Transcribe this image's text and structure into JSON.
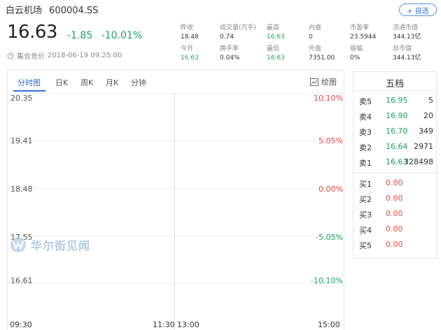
{
  "header": {
    "name": "白云机场",
    "code": "600004.SS",
    "add_button": "+ 自选"
  },
  "quote": {
    "price": "16.63",
    "change": "-1.85",
    "change_pct": "-10.01%",
    "auction_label": "集合竞价",
    "auction_time": "2018-06-19 09:25:00"
  },
  "stats": [
    {
      "label": "昨收",
      "value": "18.48",
      "color": "normal"
    },
    {
      "label": "成交量(万手)",
      "value": "0.74",
      "color": "normal"
    },
    {
      "label": "最高",
      "value": "16.63",
      "color": "green"
    },
    {
      "label": "内盘",
      "value": "0",
      "color": "normal"
    },
    {
      "label": "市盈率",
      "value": "23.5944",
      "color": "normal"
    },
    {
      "label": "流通市值",
      "value": "344.13亿",
      "color": "normal"
    },
    {
      "label": "今开",
      "value": "16.63",
      "color": "green"
    },
    {
      "label": "换手率",
      "value": "0.04%",
      "color": "normal"
    },
    {
      "label": "最低",
      "value": "16.63",
      "color": "green"
    },
    {
      "label": "外盘",
      "value": "7351.00",
      "color": "normal"
    },
    {
      "label": "振幅",
      "value": "0%",
      "color": "normal"
    },
    {
      "label": "总市值",
      "value": "344.13亿",
      "color": "normal"
    }
  ],
  "tabs": [
    "分时图",
    "日K",
    "周K",
    "月K",
    "分钟"
  ],
  "draw_button": "绘图",
  "chart": {
    "y_labels": [
      "20.35",
      "19.41",
      "18.48",
      "17.55",
      "16.61"
    ],
    "pct_labels": [
      {
        "text": "10.10%",
        "color": "#e24a4a"
      },
      {
        "text": "5.05%",
        "color": "#e24a4a"
      },
      {
        "text": "0.00%",
        "color": "#e24a4a"
      },
      {
        "text": "-5.05%",
        "color": "#1aa260"
      },
      {
        "text": "-10.10%",
        "color": "#1aa260"
      }
    ],
    "x_labels": [
      "09:30",
      "11:30",
      "13:00",
      "15:00"
    ]
  },
  "watermark": "华尔街见闻",
  "orderbook": {
    "title": "五档",
    "asks": [
      {
        "label": "卖5",
        "price": "16.95",
        "vol": "5"
      },
      {
        "label": "卖4",
        "price": "16.90",
        "vol": "20"
      },
      {
        "label": "卖3",
        "price": "16.70",
        "vol": "349"
      },
      {
        "label": "卖2",
        "price": "16.64",
        "vol": "2971"
      },
      {
        "label": "卖1",
        "price": "16.63",
        "vol": "328498"
      }
    ],
    "bids": [
      {
        "label": "买1",
        "price": "0.00",
        "vol": ""
      },
      {
        "label": "买2",
        "price": "0.00",
        "vol": ""
      },
      {
        "label": "买3",
        "price": "0.00",
        "vol": ""
      },
      {
        "label": "买4",
        "price": "0.00",
        "vol": ""
      },
      {
        "label": "买5",
        "price": "0.00",
        "vol": ""
      }
    ]
  },
  "colors": {
    "accent": "#2f6fd6",
    "down": "#1aa260",
    "up": "#e24a4a"
  }
}
